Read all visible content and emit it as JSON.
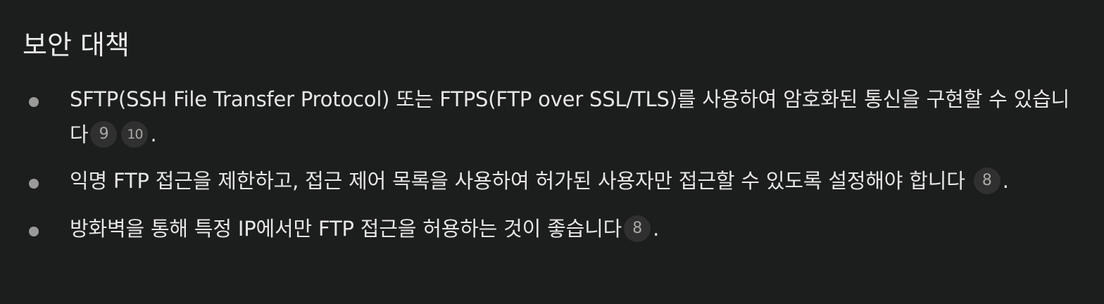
{
  "section": {
    "heading": "보안 대책",
    "items": [
      {
        "text": "SFTP(SSH File Transfer Protocol) 또는 FTPS(FTP over SSL/TLS)를 사용하여 암호화된 통신을 구현할 수 있습니다",
        "citations": [
          "9",
          "10"
        ],
        "end": "."
      },
      {
        "text": "익명 FTP 접근을 제한하고, 접근 제어 목록을 사용하여 허가된 사용자만 접근할 수 있도록 설정해야 합니다",
        "citations": [
          "8"
        ],
        "end": "."
      },
      {
        "text": "방화벽을 통해 특정 IP에서만 FTP 접근을 허용하는 것이 좋습니다",
        "citations": [
          "8"
        ],
        "end": "."
      }
    ]
  },
  "colors": {
    "background": "#1c1d1d",
    "text": "#e6e6e4",
    "bullet": "#9a9a98",
    "citation_badge": "#2f302f"
  }
}
